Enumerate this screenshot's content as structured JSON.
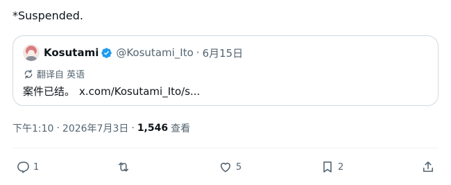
{
  "post": {
    "text": "*Suspended."
  },
  "quote": {
    "display_name": "Kosutami",
    "handle": "@Kosutami_Ito",
    "separator": "·",
    "date": "6月15日",
    "translate_label": "翻译自 英语",
    "text": "案件已结。",
    "link": "x.com/Kosutami_Ito/s..."
  },
  "meta": {
    "time": "下午1:10",
    "sep1": "·",
    "date": "2026年7月3日",
    "sep2": "·",
    "views_count": "1,546",
    "views_label": "查看"
  },
  "actions": {
    "reply_count": "1",
    "retweet_count": "",
    "like_count": "5",
    "bookmark_count": "2"
  },
  "colors": {
    "text": "#0f1419",
    "secondary": "#536471",
    "verified": "#1d9bf0",
    "border": "#cfd9de"
  }
}
